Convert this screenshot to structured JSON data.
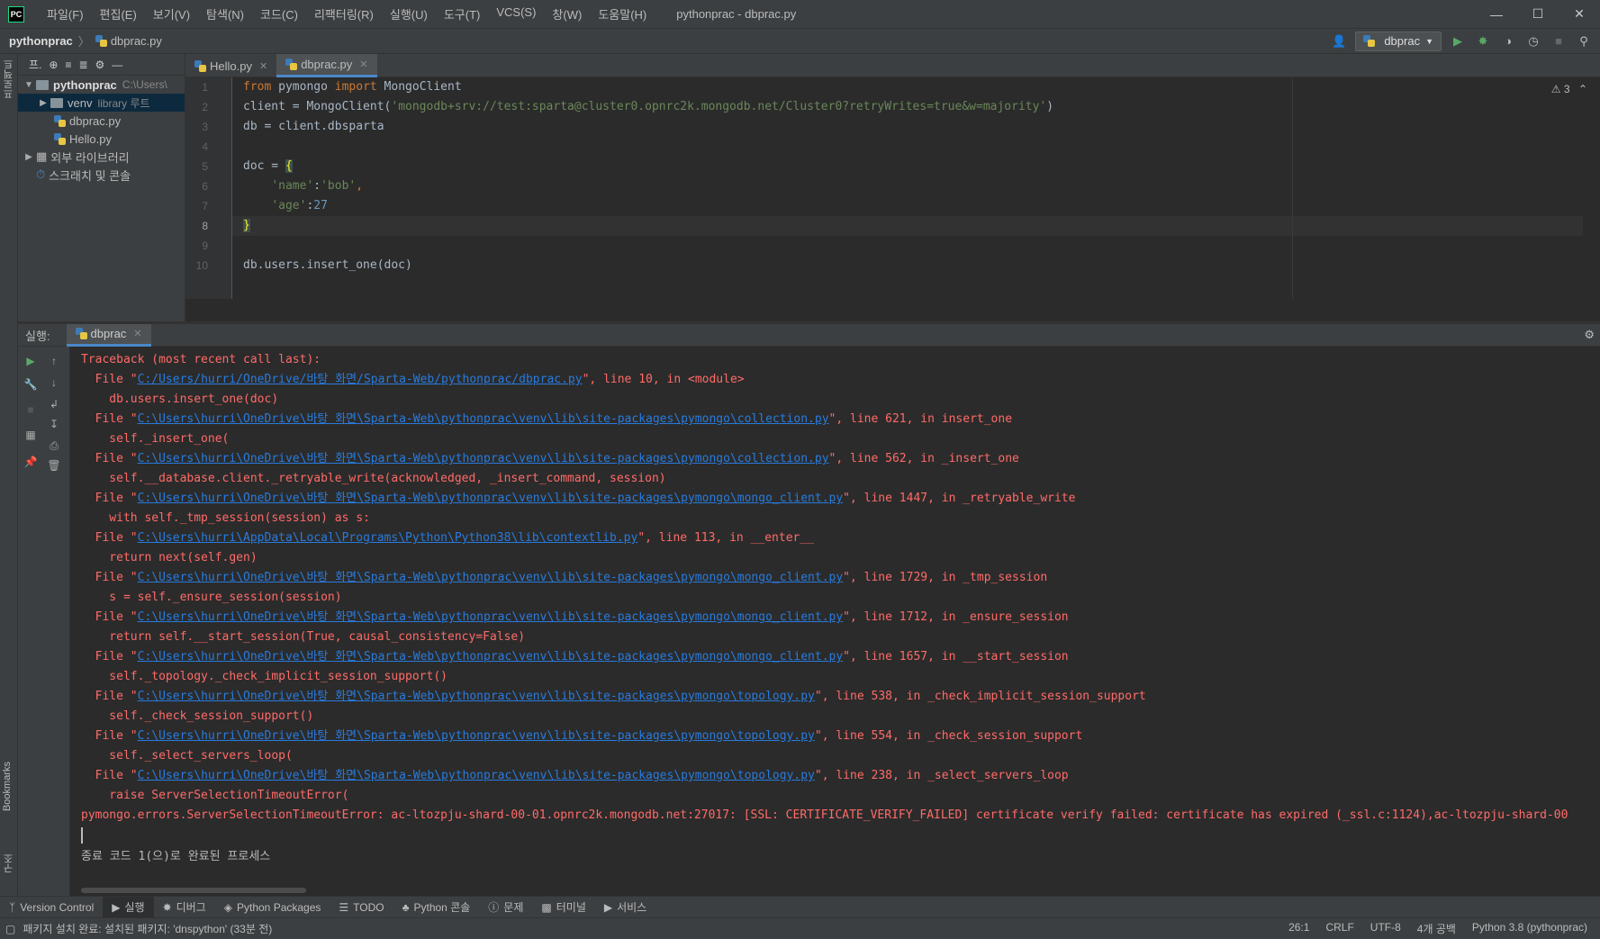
{
  "app": {
    "logo": "PC",
    "window_title": "pythonprac - dbprac.py"
  },
  "menu": [
    "파일(F)",
    "편집(E)",
    "보기(V)",
    "탐색(N)",
    "코드(C)",
    "리팩터링(R)",
    "실행(U)",
    "도구(T)",
    "VCS(S)",
    "창(W)",
    "도움말(H)"
  ],
  "breadcrumb": {
    "project": "pythonprac",
    "file": "dbprac.py"
  },
  "toolbar": {
    "run_config": "dbprac"
  },
  "left_strip": {
    "project_tab": "프로젝트",
    "bookmarks_tab": "Bookmarks",
    "structure_tab": "구조"
  },
  "project_panel": {
    "header_label": "프.",
    "root": {
      "name": "pythonprac",
      "path": "C:\\Users\\"
    },
    "venv": {
      "name": "venv",
      "hint": "library 루트"
    },
    "files": [
      "dbprac.py",
      "Hello.py"
    ],
    "external_libs": "외부 라이브러리",
    "scratches": "스크래치 및 콘솔"
  },
  "editor": {
    "tabs": [
      {
        "label": "Hello.py"
      },
      {
        "label": "dbprac.py"
      }
    ],
    "inspection_count": "3",
    "line_numbers": [
      "1",
      "2",
      "3",
      "4",
      "5",
      "6",
      "7",
      "8",
      "9",
      "10"
    ],
    "code": {
      "l1_kw1": "from",
      "l1_mod": " pymongo ",
      "l1_kw2": "import",
      "l1_name": " MongoClient",
      "l2_pre": "client = MongoClient(",
      "l2_str": "'mongodb+srv://test:sparta@cluster0.opnrc2k.mongodb.net/Cluster0?retryWrites=true&w=majority'",
      "l2_post": ")",
      "l3": "db = client.dbsparta",
      "l5_pre": "doc = ",
      "l5_brace": "{",
      "l6_key": "'name'",
      "l6_sep": ":",
      "l6_val": "'bob'",
      "l6_end": ",",
      "l7_key": "'age'",
      "l7_sep": ":",
      "l7_val": "27",
      "l8_brace": "}",
      "l10": "db.users.insert_one(doc)"
    }
  },
  "run_panel": {
    "title": "실행:",
    "tab": "dbprac",
    "console": [
      {
        "text": "Traceback (most recent call last):"
      },
      {
        "pre": "  File \"",
        "link": "C:/Users/hurri/OneDrive/바탕 화면/Sparta-Web/pythonprac/dbprac.py",
        "post": "\", line 10, in <module>"
      },
      {
        "text": "    db.users.insert_one(doc)"
      },
      {
        "pre": "  File \"",
        "link": "C:\\Users\\hurri\\OneDrive\\바탕 화면\\Sparta-Web\\pythonprac\\venv\\lib\\site-packages\\pymongo\\collection.py",
        "post": "\", line 621, in insert_one"
      },
      {
        "text": "    self._insert_one("
      },
      {
        "pre": "  File \"",
        "link": "C:\\Users\\hurri\\OneDrive\\바탕 화면\\Sparta-Web\\pythonprac\\venv\\lib\\site-packages\\pymongo\\collection.py",
        "post": "\", line 562, in _insert_one"
      },
      {
        "text": "    self.__database.client._retryable_write(acknowledged, _insert_command, session)"
      },
      {
        "pre": "  File \"",
        "link": "C:\\Users\\hurri\\OneDrive\\바탕 화면\\Sparta-Web\\pythonprac\\venv\\lib\\site-packages\\pymongo\\mongo_client.py",
        "post": "\", line 1447, in _retryable_write"
      },
      {
        "text": "    with self._tmp_session(session) as s:"
      },
      {
        "pre": "  File \"",
        "link": "C:\\Users\\hurri\\AppData\\Local\\Programs\\Python\\Python38\\lib\\contextlib.py",
        "post": "\", line 113, in __enter__"
      },
      {
        "text": "    return next(self.gen)"
      },
      {
        "pre": "  File \"",
        "link": "C:\\Users\\hurri\\OneDrive\\바탕 화면\\Sparta-Web\\pythonprac\\venv\\lib\\site-packages\\pymongo\\mongo_client.py",
        "post": "\", line 1729, in _tmp_session"
      },
      {
        "text": "    s = self._ensure_session(session)"
      },
      {
        "pre": "  File \"",
        "link": "C:\\Users\\hurri\\OneDrive\\바탕 화면\\Sparta-Web\\pythonprac\\venv\\lib\\site-packages\\pymongo\\mongo_client.py",
        "post": "\", line 1712, in _ensure_session"
      },
      {
        "text": "    return self.__start_session(True, causal_consistency=False)"
      },
      {
        "pre": "  File \"",
        "link": "C:\\Users\\hurri\\OneDrive\\바탕 화면\\Sparta-Web\\pythonprac\\venv\\lib\\site-packages\\pymongo\\mongo_client.py",
        "post": "\", line 1657, in __start_session"
      },
      {
        "text": "    self._topology._check_implicit_session_support()"
      },
      {
        "pre": "  File \"",
        "link": "C:\\Users\\hurri\\OneDrive\\바탕 화면\\Sparta-Web\\pythonprac\\venv\\lib\\site-packages\\pymongo\\topology.py",
        "post": "\", line 538, in _check_implicit_session_support"
      },
      {
        "text": "    self._check_session_support()"
      },
      {
        "pre": "  File \"",
        "link": "C:\\Users\\hurri\\OneDrive\\바탕 화면\\Sparta-Web\\pythonprac\\venv\\lib\\site-packages\\pymongo\\topology.py",
        "post": "\", line 554, in _check_session_support"
      },
      {
        "text": "    self._select_servers_loop("
      },
      {
        "pre": "  File \"",
        "link": "C:\\Users\\hurri\\OneDrive\\바탕 화면\\Sparta-Web\\pythonprac\\venv\\lib\\site-packages\\pymongo\\topology.py",
        "post": "\", line 238, in _select_servers_loop"
      },
      {
        "text": "    raise ServerSelectionTimeoutError("
      },
      {
        "text": "pymongo.errors.ServerSelectionTimeoutError: ac-ltozpju-shard-00-01.opnrc2k.mongodb.net:27017: [SSL: CERTIFICATE_VERIFY_FAILED] certificate verify failed: certificate has expired (_ssl.c:1124),ac-ltozpju-shard-00"
      }
    ],
    "exit_message": "종료 코드 1(으)로 완료된 프로세스"
  },
  "bottom_tools": [
    "Version Control",
    "실행",
    "디버그",
    "Python Packages",
    "TODO",
    "Python 콘솔",
    "문제",
    "터미널",
    "서비스"
  ],
  "status": {
    "message": "패키지 설치 완료: 설치된 패키지: 'dnspython' (33분 전)",
    "position": "26:1",
    "line_sep": "CRLF",
    "encoding": "UTF-8",
    "indent": "4개 공백",
    "interpreter": "Python 3.8 (pythonprac)"
  },
  "colors": {
    "accent": "#4a88c7",
    "error": "#ff6b68",
    "link": "#287bde",
    "keyword": "#cc7832",
    "string": "#6a8759",
    "number": "#6897bb"
  }
}
